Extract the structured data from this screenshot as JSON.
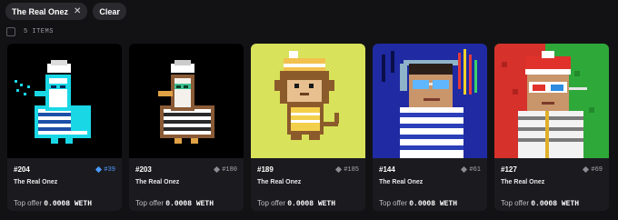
{
  "filters": {
    "collection_chip": "The Real Onez",
    "clear_label": "Clear"
  },
  "results": {
    "count_label": "5 ITEMS"
  },
  "offer_prefix": "Top offer",
  "items": [
    {
      "token": "#204",
      "rarity": "#39",
      "collection": "The Real Onez",
      "price": "0.0008 WETH",
      "rarity_color": "#4d9cff"
    },
    {
      "token": "#203",
      "rarity": "#180",
      "collection": "The Real Onez",
      "price": "0.0008 WETH",
      "rarity_color": "#a6a6ad"
    },
    {
      "token": "#189",
      "rarity": "#185",
      "collection": "The Real Onez",
      "price": "0.0008 WETH",
      "rarity_color": "#a6a6ad"
    },
    {
      "token": "#144",
      "rarity": "#61",
      "collection": "The Real Onez",
      "price": "0.0008 WETH",
      "rarity_color": "#a6a6ad"
    },
    {
      "token": "#127",
      "rarity": "#69",
      "collection": "The Real Onez",
      "price": "0.0008 WETH",
      "rarity_color": "#a6a6ad"
    }
  ]
}
